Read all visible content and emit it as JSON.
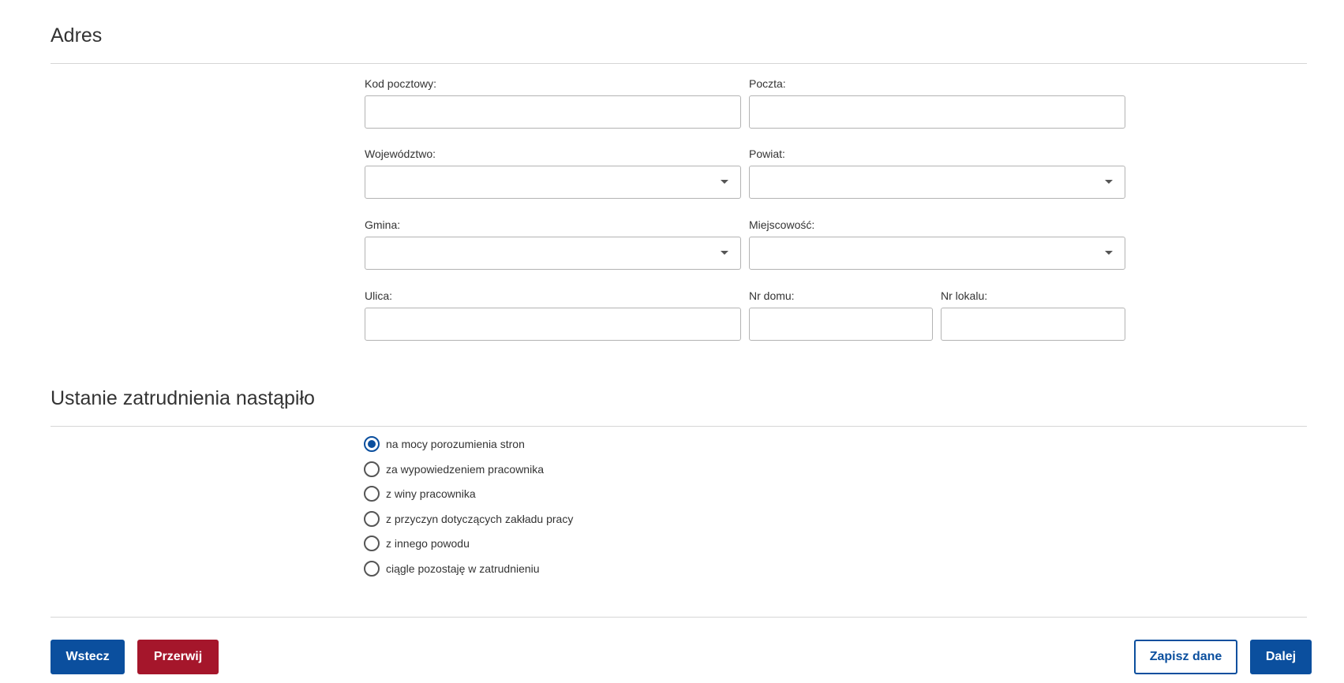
{
  "colors": {
    "primary": "#0b4f9e",
    "danger": "#a5162b",
    "border": "#b3b3b3",
    "divider": "#d6d6d6",
    "text": "#333333"
  },
  "address": {
    "title": "Adres",
    "postal_code": {
      "label": "Kod pocztowy:",
      "value": ""
    },
    "post_office": {
      "label": "Poczta:",
      "value": ""
    },
    "voivodeship": {
      "label": "Województwo:",
      "value": ""
    },
    "county": {
      "label": "Powiat:",
      "value": ""
    },
    "commune": {
      "label": "Gmina:",
      "value": ""
    },
    "locality": {
      "label": "Miejscowość:",
      "value": ""
    },
    "street": {
      "label": "Ulica:",
      "value": ""
    },
    "house_number": {
      "label": "Nr domu:",
      "value": ""
    },
    "apartment_number": {
      "label": "Nr lokalu:",
      "value": ""
    }
  },
  "employment_end": {
    "title": "Ustanie zatrudnienia nastąpiło",
    "selected_index": 0,
    "options": [
      "na mocy porozumienia stron",
      "za wypowiedzeniem pracownika",
      "z winy pracownika",
      "z przyczyn dotyczących zakładu pracy",
      "z innego powodu",
      "ciągle pozostaję w zatrudnieniu"
    ]
  },
  "footer": {
    "back_label": "Wstecz",
    "abort_label": "Przerwij",
    "save_label": "Zapisz dane",
    "next_label": "Dalej"
  }
}
